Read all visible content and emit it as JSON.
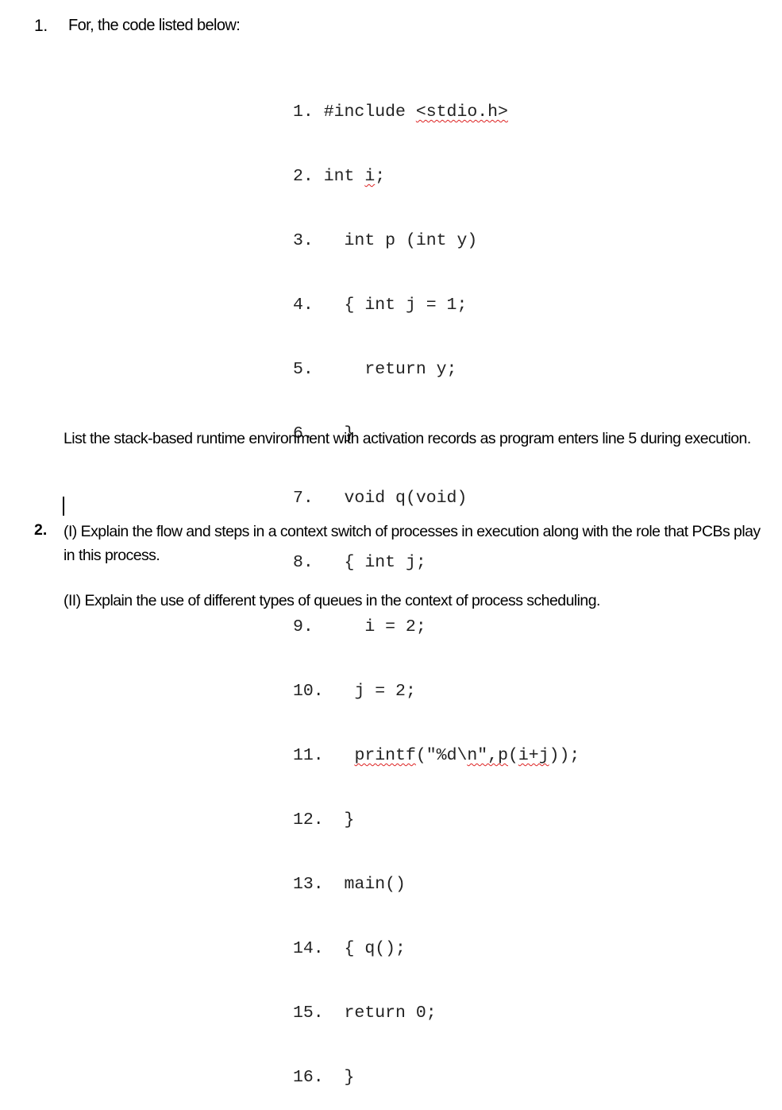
{
  "question1": {
    "number": "1.",
    "intro": "For, the code listed below:",
    "code_lines": [
      {
        "num": "1.",
        "pre": " ",
        "text": "#include <stdio.h>",
        "squiggle": "<stdio.h>"
      },
      {
        "num": "2.",
        "pre": " ",
        "text": "int i;",
        "squiggle": "i"
      },
      {
        "num": "3.",
        "pre": "   ",
        "text": "int p (int y)"
      },
      {
        "num": "4.",
        "pre": "   ",
        "text": "{ int j = 1;"
      },
      {
        "num": "5.",
        "pre": "     ",
        "text": "return y;"
      },
      {
        "num": "6.",
        "pre": "   ",
        "text": "}"
      },
      {
        "num": "7.",
        "pre": "   ",
        "text": "void q(void)"
      },
      {
        "num": "8.",
        "pre": "   ",
        "text": "{ int j;"
      },
      {
        "num": "9.",
        "pre": "     ",
        "text": "i = 2;"
      },
      {
        "num": "10.",
        "pre": "   ",
        "text": "j = 2;"
      },
      {
        "num": "11.",
        "pre": "   ",
        "text": "printf(\"%d\\n\",p(i+j));"
      },
      {
        "num": "12.",
        "pre": "  ",
        "text": "}"
      },
      {
        "num": "13.",
        "pre": "  ",
        "text": "main()"
      },
      {
        "num": "14.",
        "pre": "  ",
        "text": "{ q();"
      },
      {
        "num": "15.",
        "pre": "  ",
        "text": "return 0;"
      },
      {
        "num": "16.",
        "pre": "  ",
        "text": "}"
      }
    ],
    "prompt": "List the stack-based runtime environment with activation records as program enters line 5 during execution."
  },
  "question2": {
    "number": "2.",
    "part1": "(I) Explain the flow and steps in a context switch of processes in execution along with the role that PCBs play in this process.",
    "part2": "(II) Explain the use of different types of queues in the context of process scheduling."
  }
}
